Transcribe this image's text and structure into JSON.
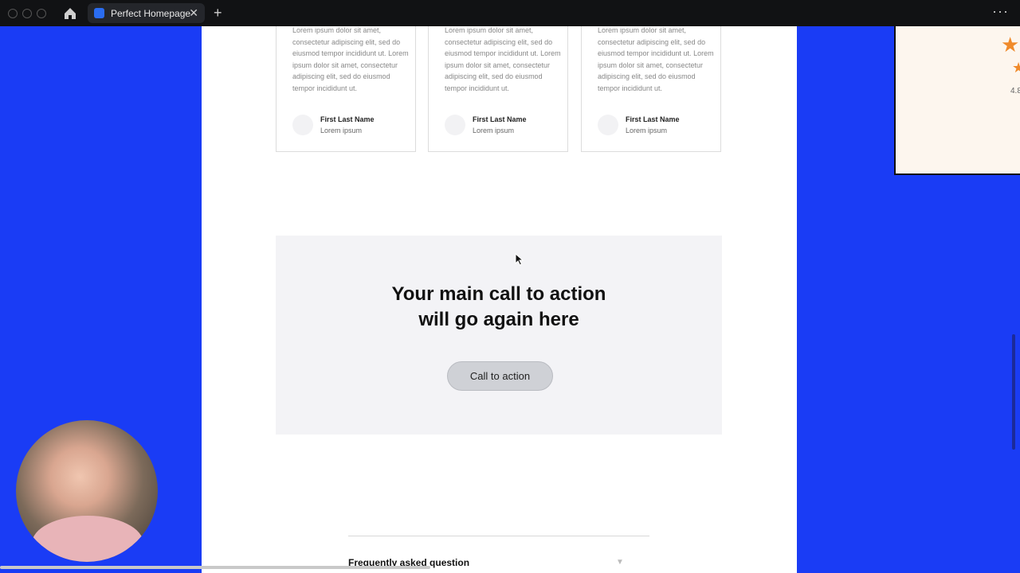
{
  "browser": {
    "tab_title": "Perfect Homepage",
    "close_glyph": "✕",
    "new_tab_glyph": "+",
    "more_glyph": "···"
  },
  "testimonials": [
    {
      "text": "Lorem ipsum dolor sit amet, consectetur adipiscing elit, sed do eiusmod tempor incididunt ut. Lorem ipsum dolor sit amet, consectetur adipiscing elit, sed do eiusmod tempor incididunt ut.",
      "name": "First Last Name",
      "role": "Lorem ipsum"
    },
    {
      "text": "Lorem ipsum dolor sit amet, consectetur adipiscing elit, sed do eiusmod tempor incididunt ut. Lorem ipsum dolor sit amet, consectetur adipiscing elit, sed do eiusmod tempor incididunt ut.",
      "name": "First Last Name",
      "role": "Lorem ipsum"
    },
    {
      "text": "Lorem ipsum dolor sit amet, consectetur adipiscing elit, sed do eiusmod tempor incididunt ut. Lorem ipsum dolor sit amet, consectetur adipiscing elit, sed do eiusmod tempor incididunt ut.",
      "name": "First Last Name",
      "role": "Lorem ipsum"
    }
  ],
  "cta": {
    "heading_line1": "Your main call to action",
    "heading_line2": "will go again here",
    "button_label": "Call to action"
  },
  "faq": {
    "question": "Frequently asked question",
    "arrow_glyph": "▼"
  },
  "review_panel": {
    "star_glyph": "★",
    "rating": "4.8"
  },
  "colors": {
    "background": "#1a3cf5",
    "star": "#f08a2a",
    "cta_bg": "#f3f3f6"
  }
}
